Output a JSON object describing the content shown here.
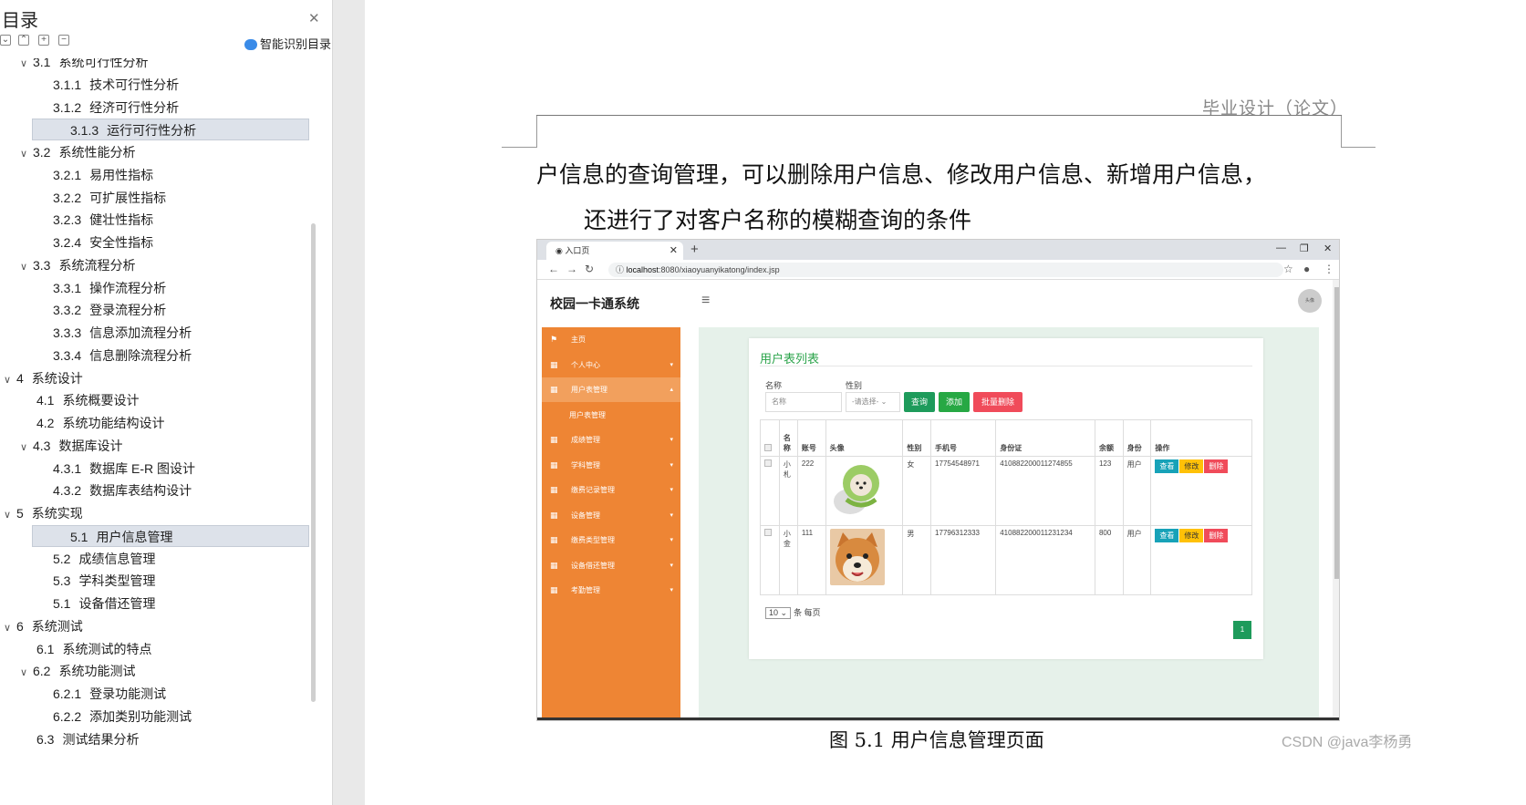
{
  "toc": {
    "title": "目录",
    "smart_label": "智能识别目录",
    "items": [
      {
        "num": "3.1",
        "label": "系统可行性分析",
        "level": 2,
        "expanded": true
      },
      {
        "num": "3.1.1",
        "label": "技术可行性分析",
        "level": 3
      },
      {
        "num": "3.1.2",
        "label": "经济可行性分析",
        "level": 3
      },
      {
        "num": "3.1.3",
        "label": "运行可行性分析",
        "level": 3,
        "selected": true
      },
      {
        "num": "3.2",
        "label": "系统性能分析",
        "level": 2,
        "expanded": true
      },
      {
        "num": "3.2.1",
        "label": "易用性指标",
        "level": 3
      },
      {
        "num": "3.2.2",
        "label": "可扩展性指标",
        "level": 3
      },
      {
        "num": "3.2.3",
        "label": "健壮性指标",
        "level": 3
      },
      {
        "num": "3.2.4",
        "label": "安全性指标",
        "level": 3
      },
      {
        "num": "3.3",
        "label": "系统流程分析",
        "level": 2,
        "expanded": true
      },
      {
        "num": "3.3.1",
        "label": "操作流程分析",
        "level": 3
      },
      {
        "num": "3.3.2",
        "label": "登录流程分析",
        "level": 3
      },
      {
        "num": "3.3.3",
        "label": "信息添加流程分析",
        "level": 3
      },
      {
        "num": "3.3.4",
        "label": "信息删除流程分析",
        "level": 3
      },
      {
        "num": "4",
        "label": "系统设计",
        "level": 1,
        "expanded": true
      },
      {
        "num": "4.1",
        "label": "系统概要设计",
        "level": 2
      },
      {
        "num": "4.2",
        "label": "系统功能结构设计",
        "level": 2
      },
      {
        "num": "4.3",
        "label": "数据库设计",
        "level": 2,
        "expanded": true
      },
      {
        "num": "4.3.1",
        "label": "数据库 E-R 图设计",
        "level": 3
      },
      {
        "num": "4.3.2",
        "label": "数据库表结构设计",
        "level": 3
      },
      {
        "num": "5",
        "label": "系统实现",
        "level": 1,
        "expanded": true
      },
      {
        "num": "5.1",
        "label": "用户信息管理",
        "level": 3,
        "selected": true
      },
      {
        "num": "5.2",
        "label": "成绩信息管理",
        "level": 3
      },
      {
        "num": "5.3",
        "label": "学科类型管理",
        "level": 3
      },
      {
        "num": "5.1",
        "label": "设备借还管理",
        "level": 3
      },
      {
        "num": "6",
        "label": "系统测试",
        "level": 1,
        "expanded": true
      },
      {
        "num": "6.1",
        "label": "系统测试的特点",
        "level": 2
      },
      {
        "num": "6.2",
        "label": "系统功能测试",
        "level": 2,
        "expanded": true
      },
      {
        "num": "6.2.1",
        "label": "登录功能测试",
        "level": 3
      },
      {
        "num": "6.2.2",
        "label": "添加类别功能测试",
        "level": 3
      },
      {
        "num": "6.3",
        "label": "测试结果分析",
        "level": 2
      }
    ]
  },
  "page": {
    "header": "毕业设计（论文）",
    "line1": "户信息的查询管理，可以删除用户信息、修改用户信息、新增用户信息，",
    "line2": "还进行了对客户名称的模糊查询的条件",
    "caption": "图 5.1  用户信息管理页面",
    "watermark": "CSDN @java李杨勇"
  },
  "shot": {
    "tab_title": "入口页",
    "url_host": "localhost",
    "url_rest": ":8080/xiaoyuanyikatong/index.jsp",
    "brand": "校园一卡通系统",
    "avatar_text": "头像",
    "sidebar": [
      {
        "icon": "⚑",
        "label": "主页",
        "arrow": false
      },
      {
        "icon": "▦",
        "label": "个人中心",
        "arrow": true
      },
      {
        "icon": "▦",
        "label": "用户表管理",
        "arrow": true,
        "active": true
      },
      {
        "icon": "",
        "label": "用户表管理",
        "arrow": false,
        "sub": true
      },
      {
        "icon": "▦",
        "label": "成绩管理",
        "arrow": true
      },
      {
        "icon": "▦",
        "label": "学科管理",
        "arrow": true
      },
      {
        "icon": "▦",
        "label": "缴费记录管理",
        "arrow": true
      },
      {
        "icon": "▦",
        "label": "设备管理",
        "arrow": true
      },
      {
        "icon": "▦",
        "label": "缴费类型管理",
        "arrow": true
      },
      {
        "icon": "▦",
        "label": "设备借还管理",
        "arrow": true
      },
      {
        "icon": "▦",
        "label": "考勤管理",
        "arrow": true
      }
    ],
    "card_title": "用户表列表",
    "filter": {
      "name_label": "名称",
      "name_placeholder": "名称",
      "gender_label": "性别",
      "gender_value": "-请选择-",
      "query": "查询",
      "add": "添加",
      "batch_delete": "批量删除"
    },
    "columns": [
      "",
      "名称",
      "账号",
      "头像",
      "性别",
      "手机号",
      "身份证",
      "余额",
      "身份",
      "操作"
    ],
    "rows": [
      {
        "name": "小札",
        "account": "222",
        "avatar": "cabbage-dog",
        "gender": "女",
        "phone": "17754548971",
        "idcard": "410882200011274855",
        "balance": "123",
        "role": "用户"
      },
      {
        "name": "小金",
        "account": "111",
        "avatar": "shiba-dog",
        "gender": "男",
        "phone": "17796312333",
        "idcard": "410882200011231234",
        "balance": "800",
        "role": "用户"
      }
    ],
    "actions": {
      "view": "查看",
      "edit": "修改",
      "delete": "删除"
    },
    "pager": {
      "size": "10",
      "per_page": "条 每页",
      "current": "1"
    }
  },
  "colors": {
    "sidebar": "#ee8534",
    "accent_green": "#2aa34a",
    "btn_query": "#1e9b5b",
    "btn_add": "#27a844",
    "btn_del": "#f04b5a",
    "btn_view": "#17a2b8",
    "btn_edit": "#ffc107"
  }
}
